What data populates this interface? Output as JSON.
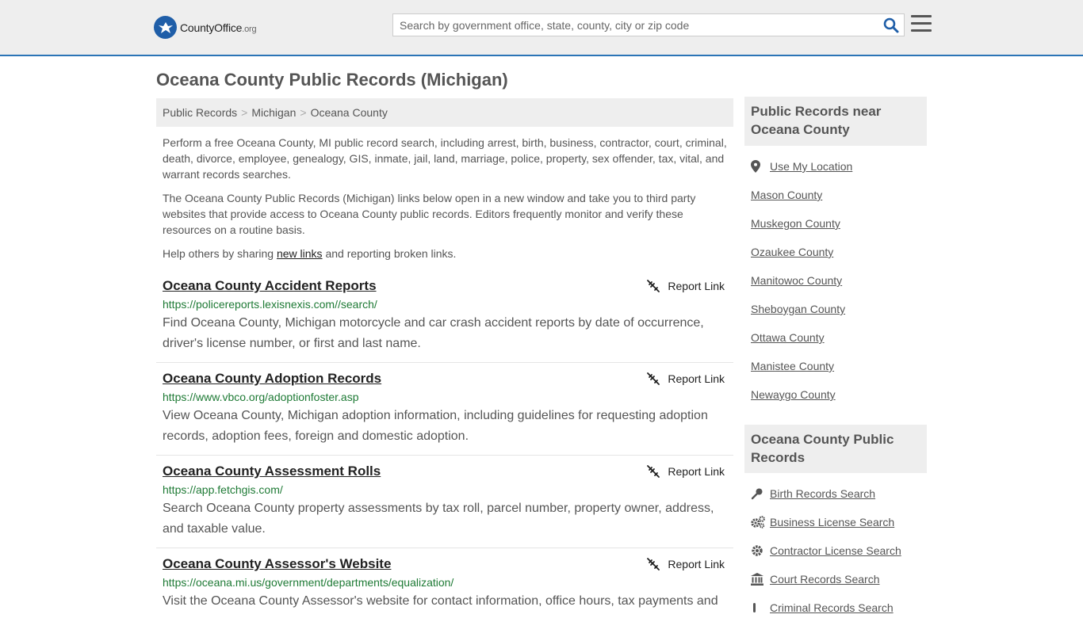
{
  "header": {
    "logo": {
      "brand": "CountyOffice",
      "tld": ".org"
    },
    "search": {
      "placeholder": "Search by government office, state, county, city or zip code",
      "value": ""
    }
  },
  "page": {
    "title": "Oceana County Public Records (Michigan)"
  },
  "breadcrumb": [
    "Public Records",
    "Michigan",
    "Oceana County"
  ],
  "intro": {
    "p1": "Perform a free Oceana County, MI public record search, including arrest, birth, business, contractor, court, criminal, death, divorce, employee, genealogy, GIS, inmate, jail, land, marriage, police, property, sex offender, tax, vital, and warrant records searches.",
    "p2": "The Oceana County Public Records (Michigan) links below open in a new window and take you to third party websites that provide access to Oceana County public records. Editors frequently monitor and verify these resources on a routine basis.",
    "p3_before": "Help others by sharing ",
    "p3_link": "new links",
    "p3_after": " and reporting broken links."
  },
  "records": [
    {
      "title": "Oceana County Accident Reports",
      "url": "https://policereports.lexisnexis.com//search/",
      "desc": "Find Oceana County, Michigan motorcycle and car crash accident reports by date of occurrence, driver's license number, or first and last name.",
      "report": "Report Link"
    },
    {
      "title": "Oceana County Adoption Records",
      "url": "https://www.vbco.org/adoptionfoster.asp",
      "desc": "View Oceana County, Michigan adoption information, including guidelines for requesting adoption records, adoption fees, foreign and domestic adoption.",
      "report": "Report Link"
    },
    {
      "title": "Oceana County Assessment Rolls",
      "url": "https://app.fetchgis.com/",
      "desc": "Search Oceana County property assessments by tax roll, parcel number, property owner, address, and taxable value.",
      "report": "Report Link"
    },
    {
      "title": "Oceana County Assessor's Website",
      "url": "https://oceana.mi.us/government/departments/equalization/",
      "desc": "Visit the Oceana County Assessor's website for contact information, office hours, tax payments and",
      "report": "Report Link"
    }
  ],
  "sidebar": {
    "near_heading": "Public Records near Oceana County",
    "near_items": [
      {
        "label": "Use My Location",
        "icon": "location-pin-icon"
      },
      {
        "label": "Mason County"
      },
      {
        "label": "Muskegon County"
      },
      {
        "label": "Ozaukee County"
      },
      {
        "label": "Manitowoc County"
      },
      {
        "label": "Sheboygan County"
      },
      {
        "label": "Ottawa County"
      },
      {
        "label": "Manistee County"
      },
      {
        "label": "Newaygo County"
      }
    ],
    "records_heading": "Oceana County Public Records",
    "records_items": [
      {
        "label": "Birth Records Search",
        "icon": "baby-rattle-icon"
      },
      {
        "label": "Business License Search",
        "icon": "gears-icon"
      },
      {
        "label": "Contractor License Search",
        "icon": "gear-icon"
      },
      {
        "label": "Court Records Search",
        "icon": "courthouse-icon"
      },
      {
        "label": "Criminal Records Search",
        "icon": "handcuffs-icon"
      }
    ]
  },
  "colors": {
    "accent": "#2b74b6",
    "url_green": "#1e7a35",
    "header_bg": "#eeeeee"
  }
}
